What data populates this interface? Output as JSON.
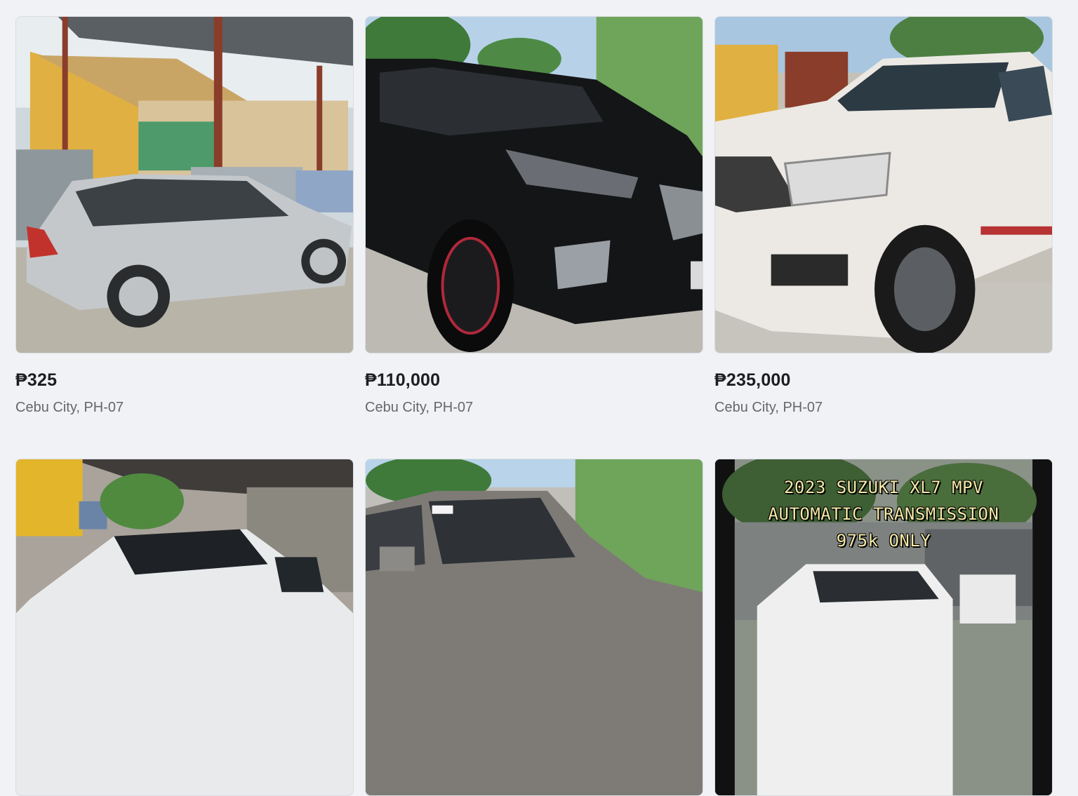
{
  "listings": [
    {
      "price": "₱325",
      "location": "Cebu City, PH-07",
      "photo_subject": "silver sedan under carport"
    },
    {
      "price": "₱110,000",
      "location": "Cebu City, PH-07",
      "photo_subject": "black SUV"
    },
    {
      "price": "₱235,000",
      "location": "Cebu City, PH-07",
      "photo_subject": "white pickup truck"
    },
    {
      "photo_subject": "white sedan under shade net"
    },
    {
      "photo_subject": "gray pickup truck"
    },
    {
      "photo_subject": "white MPV with text overlay",
      "overlay_lines": [
        "2023 SUZUKI XL7 MPV",
        "AUTOMATIC TRANSMISSION",
        "975k ONLY"
      ]
    }
  ]
}
